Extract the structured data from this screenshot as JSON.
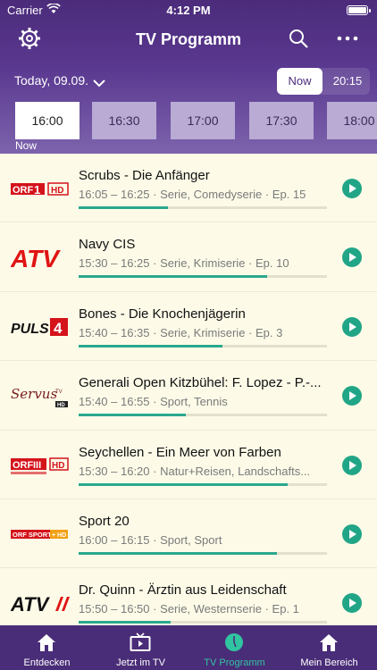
{
  "status": {
    "carrier": "Carrier",
    "time": "4:12 PM"
  },
  "header": {
    "title": "TV Programm",
    "icons": [
      "gear-icon",
      "search-icon",
      "more-icon"
    ]
  },
  "datebar": {
    "date": "Today, 09.09.",
    "segments": {
      "now": "Now",
      "later": "20:15"
    }
  },
  "slots": [
    "16:00",
    "16:30",
    "17:00",
    "17:30",
    "18:00"
  ],
  "now_label": "Now",
  "programs": [
    {
      "channel": "ORF 1 HD",
      "title": "Scrubs - Die Anfänger",
      "meta": "16:05 – 16:25 · Serie, Comedyserie · Ep. 15",
      "progress": 0.36
    },
    {
      "channel": "ATV",
      "title": "Navy CIS",
      "meta": "15:30 – 16:25 · Serie, Krimiserie · Ep. 10",
      "progress": 0.76
    },
    {
      "channel": "PULS 4",
      "title": "Bones - Die Knochenjägerin",
      "meta": "15:40 – 16:35 · Serie, Krimiserie · Ep. 3",
      "progress": 0.58
    },
    {
      "channel": "ServusTV HD",
      "title": "Generali Open Kitzbühel: F. Lopez - P.-...",
      "meta": "15:40 – 16:55 · Sport, Tennis",
      "progress": 0.43
    },
    {
      "channel": "ORF III HD",
      "title": "Seychellen - Ein Meer von Farben",
      "meta": "15:30 – 16:20 · Natur+Reisen, Landschafts...",
      "progress": 0.84
    },
    {
      "channel": "ORF SPORT + HD",
      "title": "Sport 20",
      "meta": "16:00 – 16:15 · Sport, Sport",
      "progress": 0.8
    },
    {
      "channel": "ATV II",
      "title": "Dr. Quinn - Ärztin aus Leidenschaft",
      "meta": "15:50 – 16:50 · Serie, Westernserie · Ep. 1",
      "progress": 0.37
    }
  ],
  "tabs": [
    {
      "label": "Entdecken",
      "icon": "home-icon"
    },
    {
      "label": "Jetzt im TV",
      "icon": "tv-icon"
    },
    {
      "label": "TV Programm",
      "icon": "clock-icon"
    },
    {
      "label": "Mein Bereich",
      "icon": "house-icon"
    }
  ],
  "colors": {
    "purple": "#4b2b7a",
    "accent": "#21a587",
    "background": "#fdfbe8"
  }
}
